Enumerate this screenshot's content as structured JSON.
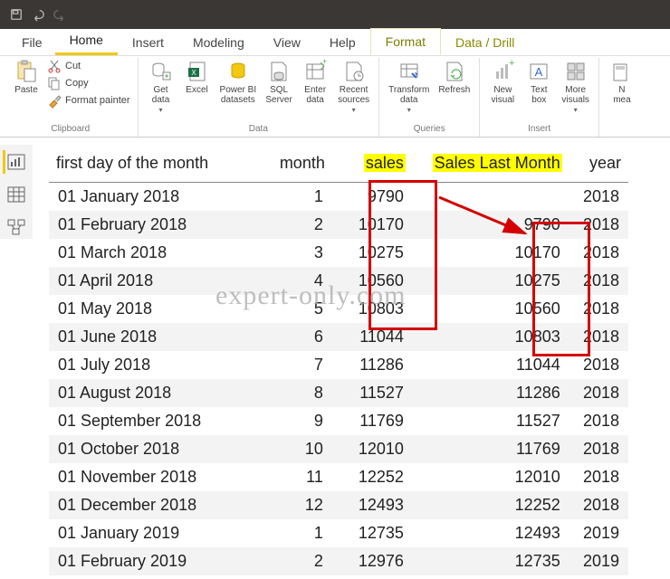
{
  "ribbon_tabs": {
    "file": "File",
    "home": "Home",
    "insert": "Insert",
    "modeling": "Modeling",
    "view": "View",
    "help": "Help",
    "format": "Format",
    "datadrill": "Data / Drill"
  },
  "clipboard": {
    "paste": "Paste",
    "cut": "Cut",
    "copy": "Copy",
    "format_painter": "Format painter",
    "group_label": "Clipboard"
  },
  "data_group": {
    "get_data": "Get\ndata",
    "excel": "Excel",
    "pbi_datasets": "Power BI\ndatasets",
    "sql_server": "SQL\nServer",
    "enter_data": "Enter\ndata",
    "recent_sources": "Recent\nsources",
    "group_label": "Data"
  },
  "queries_group": {
    "transform_data": "Transform\ndata",
    "refresh": "Refresh",
    "group_label": "Queries"
  },
  "insert_group": {
    "new_visual": "New\nvisual",
    "text_box": "Text\nbox",
    "more_visuals": "More\nvisuals",
    "group_label": "Insert"
  },
  "calc_group": {
    "new_measure": "N\nmea"
  },
  "table": {
    "headers": {
      "c1": "first day of the month",
      "c2": "month",
      "c3": "sales",
      "c4": "Sales Last Month",
      "c5": "year"
    },
    "rows": [
      {
        "c1": "01 January 2018",
        "c2": "1",
        "c3": "9790",
        "c4": "",
        "c5": "2018"
      },
      {
        "c1": "01 February 2018",
        "c2": "2",
        "c3": "10170",
        "c4": "9790",
        "c5": "2018"
      },
      {
        "c1": "01 March 2018",
        "c2": "3",
        "c3": "10275",
        "c4": "10170",
        "c5": "2018"
      },
      {
        "c1": "01 April 2018",
        "c2": "4",
        "c3": "10560",
        "c4": "10275",
        "c5": "2018"
      },
      {
        "c1": "01 May 2018",
        "c2": "5",
        "c3": "10803",
        "c4": "10560",
        "c5": "2018"
      },
      {
        "c1": "01 June 2018",
        "c2": "6",
        "c3": "11044",
        "c4": "10803",
        "c5": "2018"
      },
      {
        "c1": "01 July 2018",
        "c2": "7",
        "c3": "11286",
        "c4": "11044",
        "c5": "2018"
      },
      {
        "c1": "01 August 2018",
        "c2": "8",
        "c3": "11527",
        "c4": "11286",
        "c5": "2018"
      },
      {
        "c1": "01 September 2018",
        "c2": "9",
        "c3": "11769",
        "c4": "11527",
        "c5": "2018"
      },
      {
        "c1": "01 October 2018",
        "c2": "10",
        "c3": "12010",
        "c4": "11769",
        "c5": "2018"
      },
      {
        "c1": "01 November 2018",
        "c2": "11",
        "c3": "12252",
        "c4": "12010",
        "c5": "2018"
      },
      {
        "c1": "01 December 2018",
        "c2": "12",
        "c3": "12493",
        "c4": "12252",
        "c5": "2018"
      },
      {
        "c1": "01 January 2019",
        "c2": "1",
        "c3": "12735",
        "c4": "12493",
        "c5": "2019"
      },
      {
        "c1": "01 February 2019",
        "c2": "2",
        "c3": "12976",
        "c4": "12735",
        "c5": "2019"
      }
    ]
  },
  "watermark": "expert-only.com"
}
